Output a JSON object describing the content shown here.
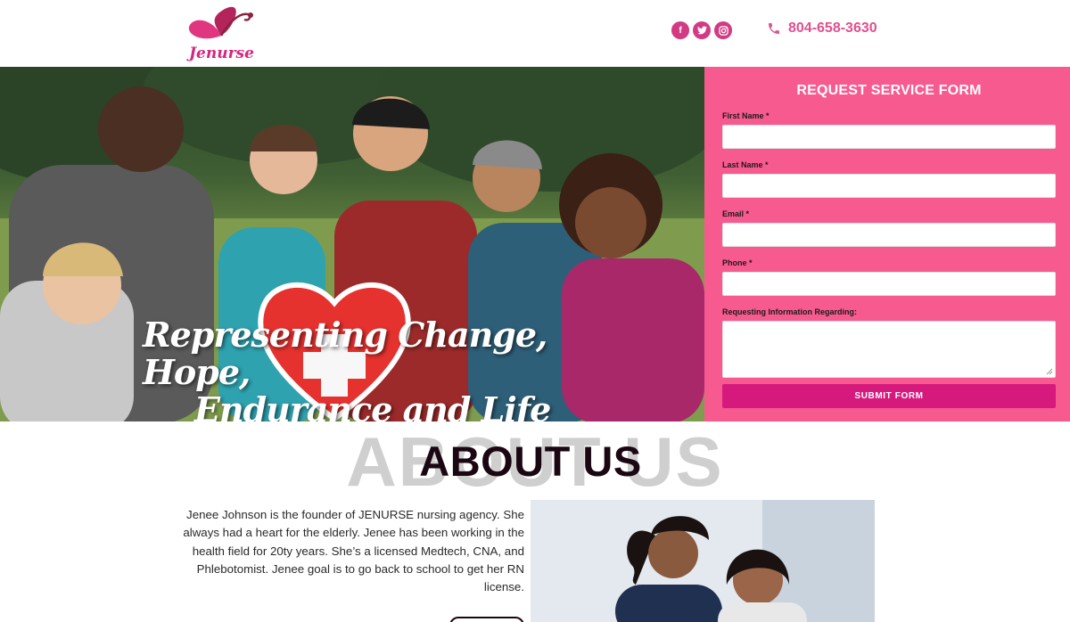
{
  "header": {
    "logo_text": "Jenurse",
    "social": [
      "facebook-icon",
      "twitter-icon",
      "instagram-icon"
    ],
    "phone": "804-658-3630"
  },
  "hero": {
    "tagline_line1": "Representing Change, Hope,",
    "tagline_line2": "Endurance and Life"
  },
  "form": {
    "title": "REQUEST SERVICE FORM",
    "fields": [
      {
        "label": "First Name",
        "required": "*"
      },
      {
        "label": "Last Name",
        "required": "*"
      },
      {
        "label": "Email",
        "required": "*"
      },
      {
        "label": "Phone",
        "required": "*"
      }
    ],
    "textarea_label": "Requesting Information Regarding:",
    "submit_label": "SUBMIT FORM"
  },
  "about": {
    "bg_text": "ABOUT US",
    "title": "ABOUT US",
    "paragraph": "Jenee Johnson is the founder of JENURSE nursing agency. She always had a heart for the elderly. Jenee has been working in the health field for 20ty years. She’s a licensed Medtech, CNA, and Phlebotomist. Jenee goal is to go back to school to get her RN license."
  },
  "colors": {
    "brand_pink": "#f75a8f",
    "accent_magenta": "#d61a7d",
    "heading_dark": "#1b0712"
  }
}
